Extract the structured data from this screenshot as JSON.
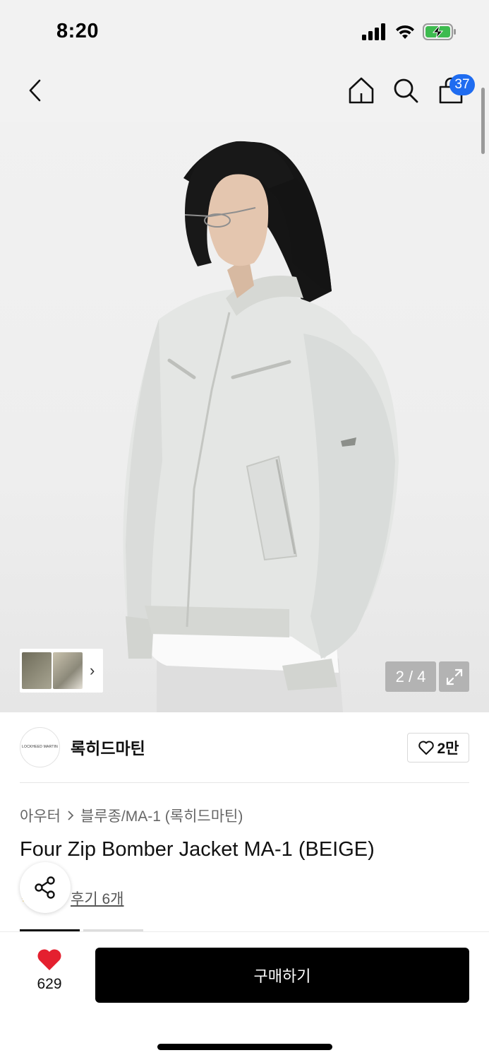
{
  "status": {
    "time": "8:20"
  },
  "header": {
    "cart_count": "37"
  },
  "gallery": {
    "counter": "2 / 4"
  },
  "brand": {
    "logo_text": "LOCKHEED MARTIN",
    "name": "록히드마틴",
    "like_count": "2만"
  },
  "breadcrumb": {
    "category": "아우터",
    "sub_category": "블루종/MA-1 (록히드마틴)"
  },
  "product": {
    "title": "Four Zip Bomber Jacket MA-1 (BEIGE)",
    "review_link": "후기 6개"
  },
  "bottom": {
    "wish_count": "629",
    "buy_label": "구매하기"
  },
  "colors": {
    "accent": "#1f6cf0",
    "heart": "#e4202f",
    "buy_button": "#000000"
  },
  "icons": [
    "back-icon",
    "home-icon",
    "search-icon",
    "cart-icon",
    "expand-icon",
    "heart-outline-icon",
    "share-icon",
    "heart-filled-icon",
    "chevron-right-icon"
  ]
}
